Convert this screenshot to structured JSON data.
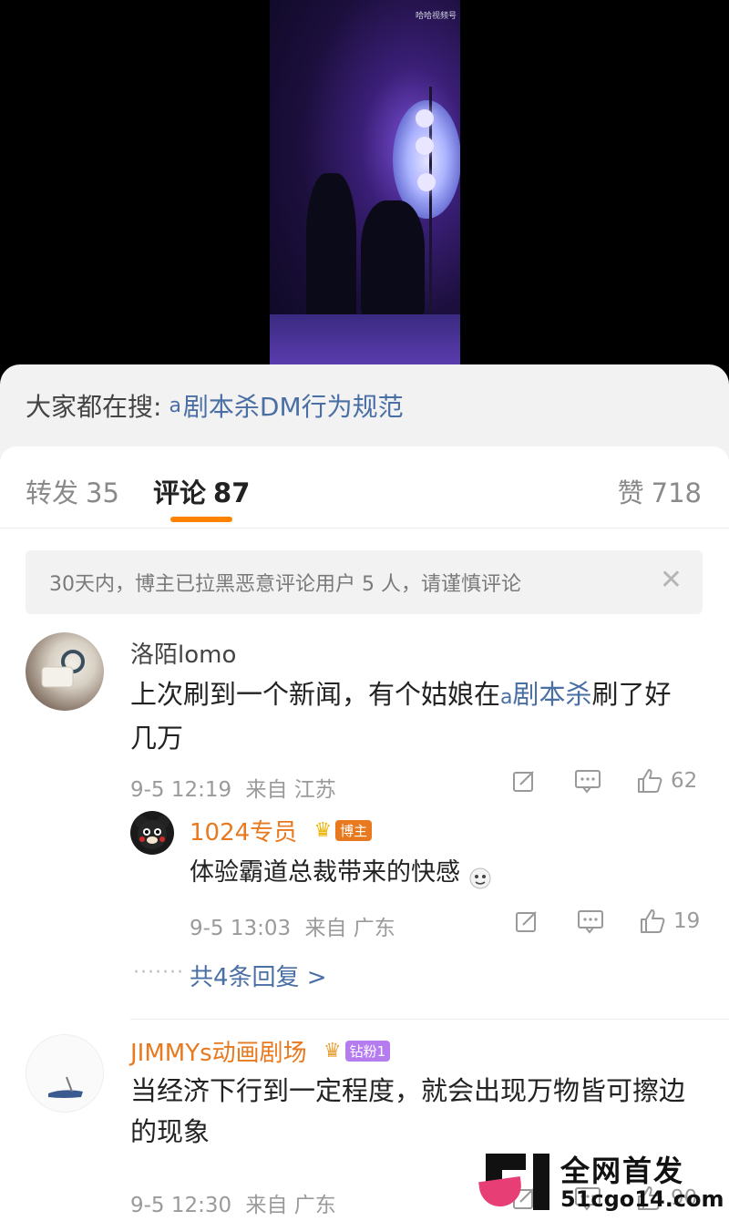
{
  "video": {
    "watermark": "哈哈视频号"
  },
  "search": {
    "prefix": "大家都在搜:",
    "query": "剧本杀DM行为规范"
  },
  "tabs": {
    "repost_label": "转发",
    "repost_count": "35",
    "comment_label": "评论",
    "comment_count": "87",
    "like_label": "赞",
    "like_count": "718"
  },
  "notice": {
    "text": "30天内，博主已拉黑恶意评论用户 5 人，请谨慎评论"
  },
  "comments": [
    {
      "user": "洛陌lomo",
      "text_before": "上次刷到一个新闻，有个姑娘在",
      "link": "剧本杀",
      "text_after": "刷了好几万",
      "time": "9-5 12:19",
      "from": "来自 江苏",
      "likes": "62",
      "reply": {
        "user": "1024专员",
        "badge": "博主",
        "text": "体验霸道总裁带来的快感",
        "time": "9-5 13:03",
        "from": "来自 广东",
        "likes": "19"
      },
      "more_replies": "共4条回复 >"
    },
    {
      "user": "JIMMYs动画剧场",
      "badge": "钻粉1",
      "text": "当经济下行到一定程度，就会出现万物皆可擦边的现象",
      "time": "9-5 12:30",
      "from": "来自 广东",
      "likes": "90"
    }
  ],
  "overlay": {
    "brand": "全网首发",
    "domain": "51cgo14.com"
  },
  "colors": {
    "accent": "#ff8200",
    "link": "#4a6fa5",
    "username_orange": "#e8791e"
  }
}
